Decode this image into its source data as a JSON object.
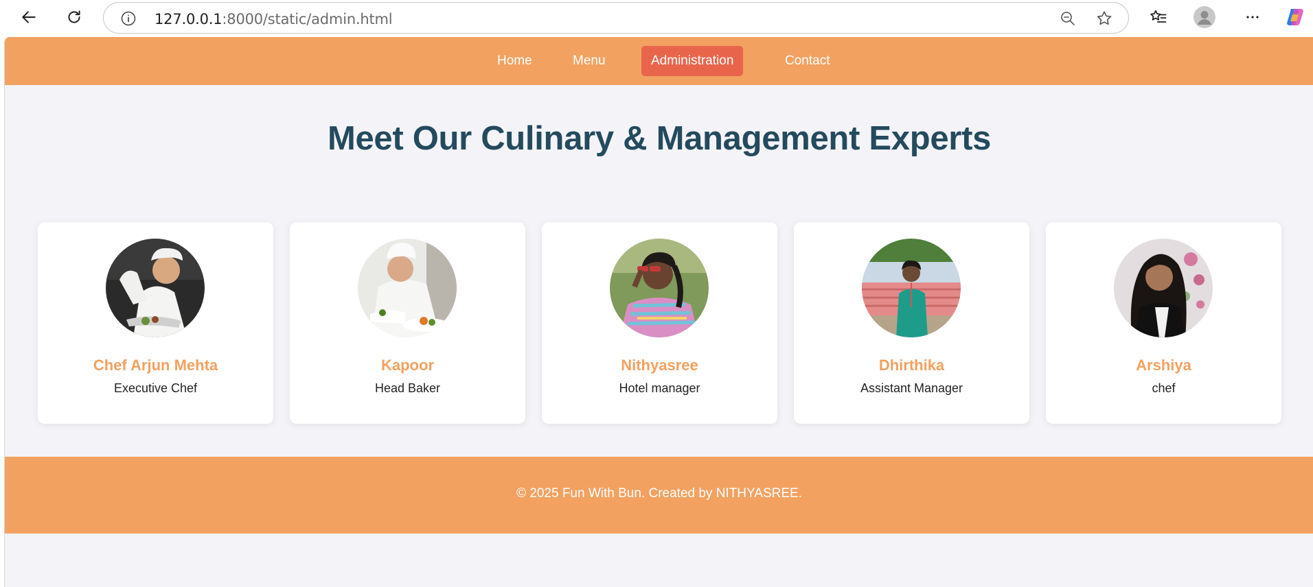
{
  "browser": {
    "url_host": "127.0.0.1",
    "url_rest": ":8000/static/admin.html"
  },
  "nav": {
    "items": [
      {
        "label": "Home",
        "active": false
      },
      {
        "label": "Menu",
        "active": false
      },
      {
        "label": "Administration",
        "active": true
      },
      {
        "label": "Contact",
        "active": false
      }
    ]
  },
  "main": {
    "title": "Meet Our Culinary & Management Experts",
    "team": [
      {
        "name": "Chef Arjun Mehta",
        "role": "Executive Chef"
      },
      {
        "name": "Kapoor",
        "role": "Head Baker"
      },
      {
        "name": "Nithyasree",
        "role": "Hotel manager"
      },
      {
        "name": "Dhirthika",
        "role": "Assistant Manager"
      },
      {
        "name": "Arshiya",
        "role": "chef"
      }
    ]
  },
  "footer": {
    "text": "© 2025 Fun With Bun. Created by NITHYASREE."
  },
  "colors": {
    "accent": "#f2a160",
    "active_nav": "#e8654c",
    "title": "#244a5e",
    "page_bg": "#f4f4f8"
  }
}
